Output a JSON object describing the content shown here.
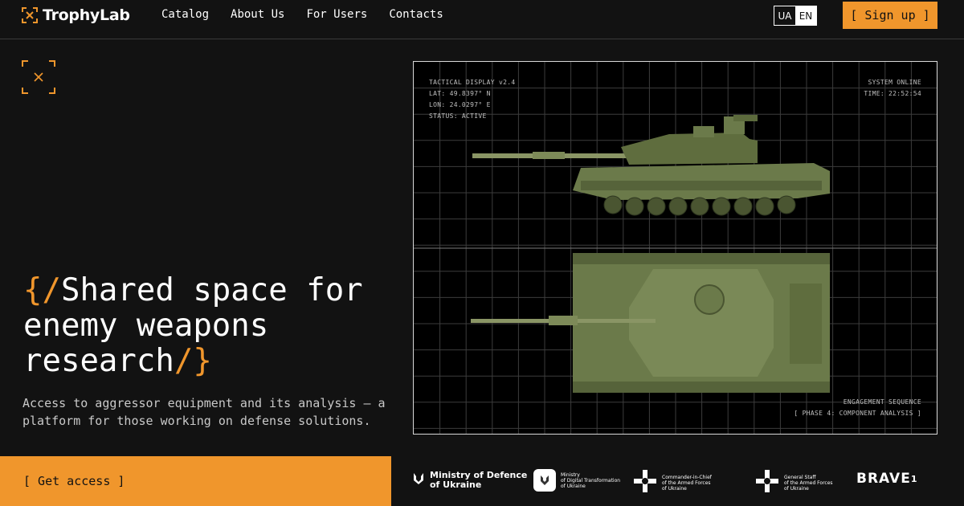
{
  "app": {
    "name": "TrophyLab"
  },
  "nav": {
    "items": [
      "Catalog",
      "About Us",
      "For Users",
      "Contacts"
    ]
  },
  "lang": {
    "ua": "UA",
    "en": "EN",
    "active": "EN"
  },
  "header": {
    "signup_label": "[ Sign up ]"
  },
  "hero": {
    "title_open": "{/",
    "title_text": "Shared space for enemy weapons research",
    "title_close": "/}",
    "description": "Access to aggressor equipment and its analysis — a platform for those working on defense solutions.",
    "cta_label": "[ Get access ]"
  },
  "display": {
    "top_left": [
      "TACTICAL DISPLAY v2.4",
      "LAT: 49.8397° N",
      "LON: 24.0297° E",
      "STATUS: ACTIVE"
    ],
    "top_right": [
      "SYSTEM ONLINE",
      "TIME: 22:52:54"
    ],
    "bottom_right": [
      "ENGAGEMENT SEQUENCE",
      "[ PHASE 4: COMPONENT ANALYSIS ]"
    ]
  },
  "partners": {
    "mod": [
      "Ministry of Defence",
      "of Ukraine"
    ],
    "mdt": [
      "Ministry",
      "of Digital Transformation",
      "of Ukraine"
    ],
    "cic": [
      "Commander-in-Chief",
      "of the Armed Forces",
      "of Ukraine"
    ],
    "gs": [
      "General Staff",
      "of the Armed Forces",
      "of Ukraine"
    ],
    "brave": "BRAVE",
    "brave_sup": "1"
  },
  "colors": {
    "accent": "#f0962c",
    "background": "#121212",
    "tank": "#6b7a4a"
  }
}
